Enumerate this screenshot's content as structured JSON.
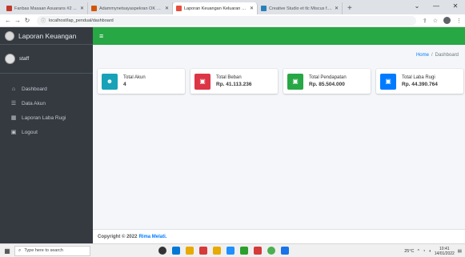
{
  "browser": {
    "tabs": [
      {
        "title": "Fanbas Masaan Asuarans #2 ...",
        "color": "#c0392b",
        "active": false
      },
      {
        "title": "Adammynetsayaspekran OK wiv...",
        "color": "#d35400",
        "active": false
      },
      {
        "title": "Laporan Keuangan Keluaran  Jo...",
        "color": "#e74c3c",
        "active": true
      },
      {
        "title": "Creative Studio et tlc Miscus f....",
        "color": "#2980b9",
        "active": false
      }
    ],
    "new_tab": "+",
    "url": "localhost/lap_pendual/dashboard",
    "window_controls": [
      "⌄",
      "—",
      "✕"
    ]
  },
  "sidebar": {
    "brand": "Laporan Keuangan",
    "user": "staff",
    "items": [
      {
        "icon": "home-icon",
        "glyph": "⌂",
        "label": "Dashboard"
      },
      {
        "icon": "users-icon",
        "glyph": "☰",
        "label": "Data Akun"
      },
      {
        "icon": "report-icon",
        "glyph": "▦",
        "label": "Laporan Laba Rugi"
      },
      {
        "icon": "logout-icon",
        "glyph": "▣",
        "label": "Logout"
      }
    ]
  },
  "topbar": {
    "menu_glyph": "≡"
  },
  "breadcrumb": {
    "home": "Home",
    "separator": "/",
    "current": "Dashboard"
  },
  "cards": [
    {
      "label": "Total Akun",
      "value": "4",
      "color": "#17a2b8",
      "icon": "users-icon",
      "glyph": "☻"
    },
    {
      "label": "Total Beban",
      "value": "Rp. 41.113.236",
      "color": "#dc3545",
      "icon": "money-icon",
      "glyph": "▣"
    },
    {
      "label": "Total Pendapatan",
      "value": "Rp. 85.504.000",
      "color": "#28a745",
      "icon": "money-icon",
      "glyph": "▣"
    },
    {
      "label": "Total Laba Rugi",
      "value": "Rp. 44.390.764",
      "color": "#007bff",
      "icon": "money-icon",
      "glyph": "▣"
    }
  ],
  "footer": {
    "prefix": "Copyright © 2022",
    "name": "Rima Melati."
  },
  "taskbar": {
    "search_placeholder": "Type here to search",
    "apps": [
      "#333333",
      "#0078d7",
      "#e8a900",
      "#d63a3a",
      "#e8a900",
      "#1e90ff",
      "#2ca02c",
      "#d63a3a",
      "#4caf50",
      "#1a73e8"
    ],
    "weather": "25°C",
    "time": "10:41",
    "date": "14/01/2022"
  }
}
